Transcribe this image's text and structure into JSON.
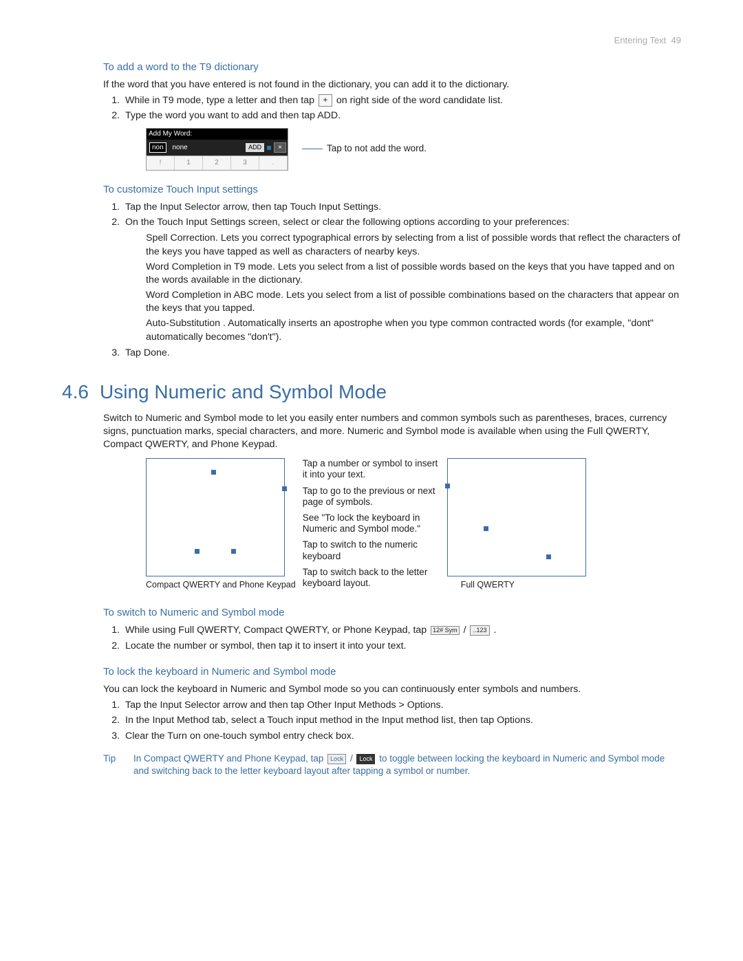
{
  "header": {
    "chapter": "Entering Text",
    "page": "49"
  },
  "sec1": {
    "title": "To add a word to the T9 dictionary",
    "intro": "If the word that you have entered is not found in the dictionary, you can add it to the dictionary.",
    "step1a": "While in T9 mode, type a letter and then tap ",
    "plus": "+",
    "step1b": " on right side of the word candidate list.",
    "step2a": "Type the word you want to add and then tap ",
    "step2b": "ADD",
    "step2c": ".",
    "fig": {
      "bar": "Add My Word:",
      "non": "non",
      "none": "none",
      "add": "ADD",
      "x": "×",
      "k1": "!",
      "k2": "1",
      "k3": "2",
      "k4": "3",
      "k5": ".",
      "note": "Tap to not add the word."
    }
  },
  "sec2": {
    "title": "To customize Touch Input settings",
    "step1a": "Tap the ",
    "step1b": "Input Selector",
    "step1c": " arrow, then tap ",
    "step1d": "Touch Input Settings",
    "step1e": ".",
    "step2": "On the Touch Input Settings screen, select or clear the following options according to your preferences:",
    "b1t": "Spell Correction",
    "b1d": ". Lets you correct typographical errors by selecting from a list of possible words that reflect the characters of the keys you have tapped as well as characters of nearby keys.",
    "b2t": "Word Completion in T9 mode",
    "b2d": ". Lets you select from a list of possible words based on the keys that you have tapped and on the words available in the dictionary.",
    "b3t": "Word Completion in ABC mode",
    "b3d": ". Lets you select from a list of possible combinations based on the characters that appear on the keys that you tapped.",
    "b4t": "Auto-Substitution",
    "b4d": " . Automatically inserts an apostrophe when you type common contracted words (for example, \"dont\" automatically becomes \"don't\").",
    "step3a": "Tap ",
    "step3b": "Done",
    "step3c": "."
  },
  "main": {
    "num": "4.6",
    "title": "Using Numeric and Symbol Mode",
    "p1a": "Switch to Numeric and Symbol mode to let you easily enter numbers and common symbols such as parentheses, braces, currency signs, punctuation marks, special characters, and more. Numeric and Symbol mode is available when using the ",
    "p1b": "Full QWERTY",
    "p1c": ", ",
    "p1d": "Compact QWERTY",
    "p1e": ", and ",
    "p1f": "Phone Keypad",
    "p1g": "."
  },
  "diagram": {
    "c1": "Tap a number or symbol to insert it into your text.",
    "c2": "Tap to go to the previous or next page of symbols.",
    "c3": "See \"To lock the keyboard in Numeric and Symbol mode.\"",
    "c4": "Tap to switch to the numeric keyboard",
    "c5": "Tap to switch back to the letter keyboard layout.",
    "left": "Compact QWERTY and Phone Keypad",
    "right": "Full QWERTY"
  },
  "sw": {
    "title": "To switch to Numeric and Symbol mode",
    "s1a": "While using Full QWERTY, Compact QWERTY, or Phone Keypad, tap ",
    "btn1": "12#\nSym",
    "slash": " / ",
    "btn2": "..123",
    "s1b": " .",
    "s2": "Locate the number or symbol, then tap it to insert it into your text."
  },
  "lock": {
    "title": "To lock the keyboard in Numeric and Symbol mode",
    "intro": "You can lock the keyboard in Numeric and Symbol mode so you can continuously enter symbols and numbers.",
    "s1a": "Tap the ",
    "s1b": "Input Selector",
    "s1c": " arrow and then tap ",
    "s1d": "Other Input Methods > Options",
    "s1e": ".",
    "s2a": "In the ",
    "s2b": "Input Method",
    "s2c": " tab, select a ",
    "s2d": "Touch",
    "s2e": " input method in the ",
    "s2f": "Input method",
    "s2g": " list, then tap ",
    "s2h": "Options",
    "s2i": ".",
    "s3a": "Clear the ",
    "s3b": "Turn on one-touch symbol entry",
    "s3c": " check box."
  },
  "tip": {
    "label": "Tip",
    "a": "In Compact QWERTY and Phone Keypad, tap ",
    "b1": "Lock",
    "slash": " / ",
    "b2": "Lock",
    "c": " to toggle between locking the keyboard in Numeric and Symbol mode and switching back to the letter keyboard layout after tapping a symbol or number."
  }
}
